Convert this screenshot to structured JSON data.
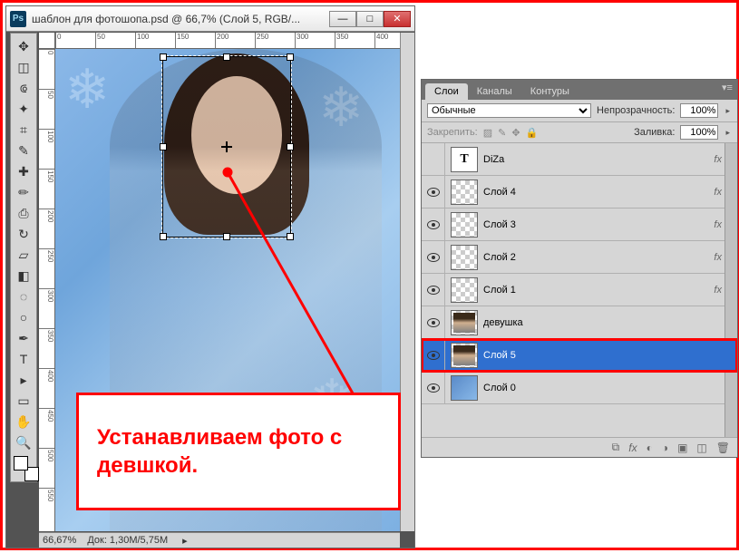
{
  "window": {
    "title": "шаблон для фотошопа.psd @ 66,7% (Слой 5, RGB/...",
    "app_icon": "Ps"
  },
  "statusbar": {
    "zoom": "66,67%",
    "docsize": "Док: 1,30M/5,75M"
  },
  "annotation": {
    "text": "Устанавливаем фото с девшкой."
  },
  "layers_panel": {
    "tabs": [
      "Слои",
      "Каналы",
      "Контуры"
    ],
    "active_tab": 0,
    "blend_mode": "Обычные",
    "opacity_label": "Непрозрачность:",
    "opacity_value": "100%",
    "lock_label": "Закрепить:",
    "fill_label": "Заливка:",
    "fill_value": "100%",
    "layers": [
      {
        "name": "DiZa",
        "visible": false,
        "thumb": "text",
        "fx": true
      },
      {
        "name": "Слой 4",
        "visible": true,
        "thumb": "checker",
        "fx": true
      },
      {
        "name": "Слой 3",
        "visible": true,
        "thumb": "checker",
        "fx": true
      },
      {
        "name": "Слой 2",
        "visible": true,
        "thumb": "checker",
        "fx": true
      },
      {
        "name": "Слой 1",
        "visible": true,
        "thumb": "checker",
        "fx": true
      },
      {
        "name": "девушка",
        "visible": true,
        "thumb": "photo",
        "fx": false
      },
      {
        "name": "Слой 5",
        "visible": true,
        "thumb": "photo",
        "fx": false,
        "selected": true
      },
      {
        "name": "Слой 0",
        "visible": true,
        "thumb": "bluebg",
        "fx": false
      }
    ]
  },
  "tools": [
    "move",
    "marquee",
    "lasso",
    "wand",
    "crop",
    "eyedropper",
    "healing",
    "brush",
    "stamp",
    "history-brush",
    "eraser",
    "gradient",
    "blur",
    "dodge",
    "pen",
    "type",
    "path-select",
    "rectangle",
    "hand",
    "zoom"
  ],
  "ruler_h": [
    "0",
    "50",
    "100",
    "150",
    "200",
    "250",
    "300",
    "350",
    "400"
  ],
  "ruler_v": [
    "0",
    "50",
    "100",
    "150",
    "200",
    "250",
    "300",
    "350",
    "400",
    "450",
    "500",
    "550"
  ]
}
